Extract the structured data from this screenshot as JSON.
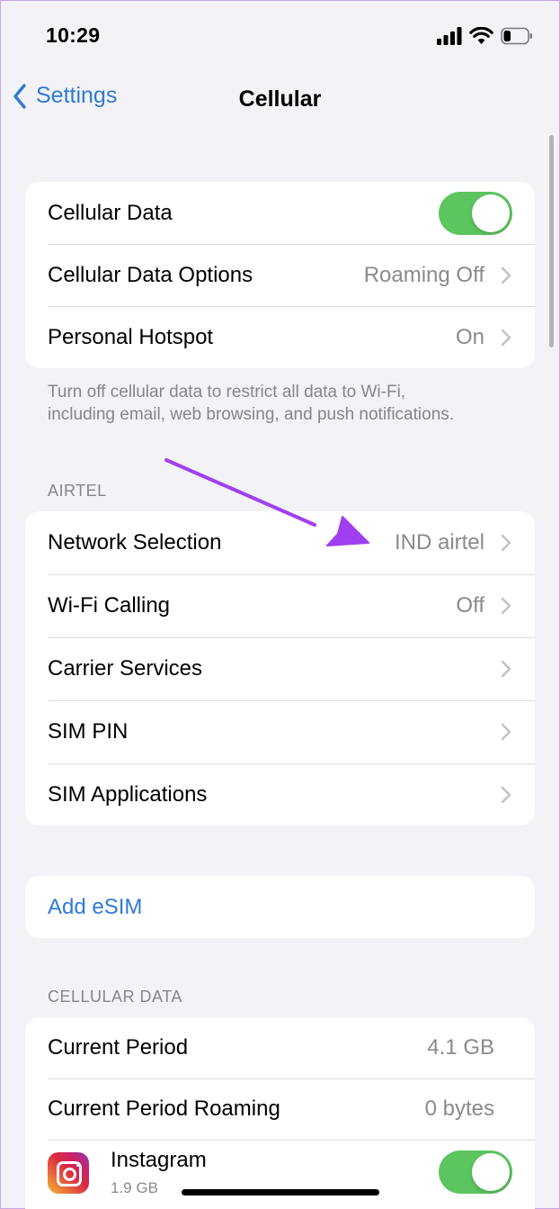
{
  "status": {
    "time": "10:29",
    "battery_level": 0.3
  },
  "nav": {
    "back_label": "Settings",
    "title": "Cellular"
  },
  "group1": {
    "rows": [
      {
        "label": "Cellular Data",
        "toggle_on": true
      },
      {
        "label": "Cellular Data Options",
        "value": "Roaming Off"
      },
      {
        "label": "Personal Hotspot",
        "value": "On"
      }
    ],
    "footer": "Turn off cellular data to restrict all data to Wi-Fi, including email, web browsing, and push notifications."
  },
  "carrier": {
    "header": "AIRTEL",
    "rows": [
      {
        "label": "Network Selection",
        "value": "IND airtel"
      },
      {
        "label": "Wi-Fi Calling",
        "value": "Off"
      },
      {
        "label": "Carrier Services"
      },
      {
        "label": "SIM PIN"
      },
      {
        "label": "SIM Applications"
      }
    ]
  },
  "esim": {
    "label": "Add eSIM"
  },
  "usage": {
    "header": "CELLULAR DATA",
    "rows": [
      {
        "label": "Current Period",
        "value": "4.1 GB"
      },
      {
        "label": "Current Period Roaming",
        "value": "0 bytes"
      }
    ],
    "apps": [
      {
        "name": "Instagram",
        "usage": "1.9 GB",
        "toggle_on": true
      }
    ]
  },
  "colors": {
    "accent": "#2f7ad6",
    "toggle_on": "#5cc55f",
    "annotation_arrow": "#a03ff0"
  }
}
